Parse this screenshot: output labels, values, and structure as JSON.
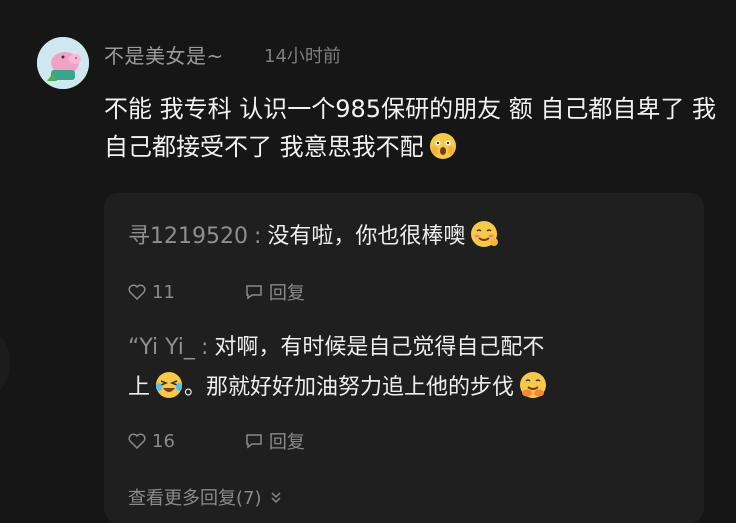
{
  "comment": {
    "username": "不是美女是~",
    "time": "14小时前",
    "text": "不能 我专科 认识一个985保研的朋友 额 自己都自卑了 我自己都接受不了 我意思我不配"
  },
  "replies": [
    {
      "name": "寻1219520",
      "text": "没有啦，你也很棒噢",
      "likes": "11",
      "reply_label": "回复"
    },
    {
      "name": "“Yi Yi_",
      "text_line1": "对啊，有时候是自己觉得自己配不",
      "text_line2_a": "上",
      "text_line2_b": "。那就好好加油努力追上他的步伐",
      "likes": "16",
      "reply_label": "回复"
    }
  ],
  "more_replies": "查看更多回复(7)",
  "icons": {
    "like": "heart-outline-icon",
    "reply": "speech-bubble-icon",
    "expand": "chevron-double-down-icon"
  }
}
